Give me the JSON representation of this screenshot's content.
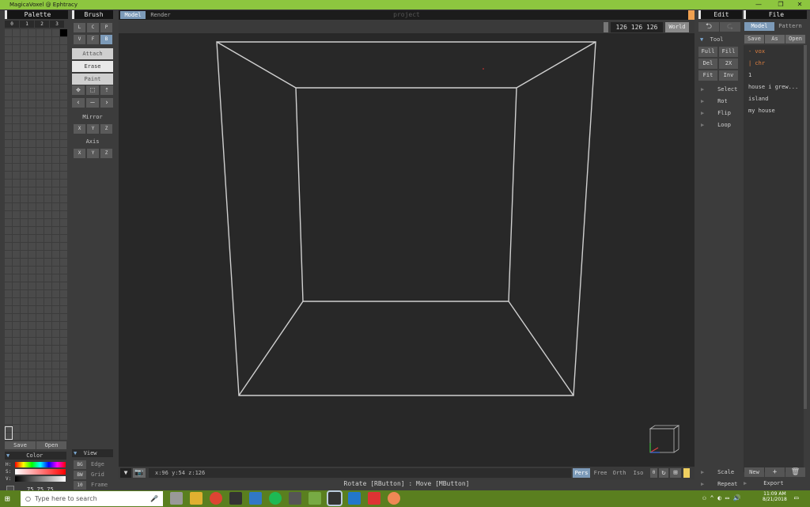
{
  "window": {
    "title": "MagicaVoxel @ Ephtracy",
    "minimize": "—",
    "restore": "❐",
    "close": "✕"
  },
  "palette": {
    "title": "Palette",
    "tabs": [
      "0",
      "1",
      "2",
      "3"
    ],
    "save": "Save",
    "open": "Open"
  },
  "brush": {
    "title": "Brush",
    "modes": [
      "L",
      "C",
      "P",
      "V",
      "F",
      "B"
    ],
    "actions": [
      "Attach",
      "Erase",
      "Paint"
    ],
    "mirror_label": "Mirror",
    "mirror": [
      "X",
      "Y",
      "Z"
    ],
    "axis_label": "Axis",
    "axis": [
      "X",
      "Y",
      "Z"
    ]
  },
  "color": {
    "title": "Color",
    "h": "H:",
    "s": "S:",
    "v": "V:",
    "rgb": "75 75 75"
  },
  "view": {
    "title": "View",
    "items": [
      {
        "key": "BG",
        "label": "Edge"
      },
      {
        "key": "BW",
        "label": "Grid"
      },
      {
        "key": "10",
        "label": "Frame"
      }
    ]
  },
  "tabs": {
    "model": "Model",
    "render": "Render",
    "project": "project"
  },
  "dims": {
    "value": "126 126 126",
    "world": "World"
  },
  "status": {
    "coords": "x:96  y:54  z:126",
    "hint": "Rotate [RButton] : Move [MButton]"
  },
  "cam_modes": [
    "Pers",
    "Free",
    "Orth",
    "Iso"
  ],
  "cam_value": "0",
  "edit": {
    "title": "Edit",
    "tool": "Tool",
    "tool_buttons": [
      "Full",
      "Fill",
      "Del",
      "2X",
      "Fit",
      "Inv"
    ],
    "items": [
      "Select",
      "Rot",
      "Flip",
      "Loop"
    ],
    "bottom": [
      "Scale",
      "Repeat"
    ]
  },
  "file": {
    "title": "File",
    "tabs": [
      "Model",
      "Pattern"
    ],
    "buttons": [
      "Save",
      "As",
      "Open"
    ],
    "tree": [
      "- vox",
      "| chr",
      "1",
      "house i grew...",
      "island",
      "my house"
    ],
    "bottom_buttons": [
      "New",
      "+",
      "🗑"
    ],
    "export": "Export"
  },
  "taskbar": {
    "search": "Type here to search",
    "time": "11:09 AM",
    "date": "8/21/2018"
  }
}
